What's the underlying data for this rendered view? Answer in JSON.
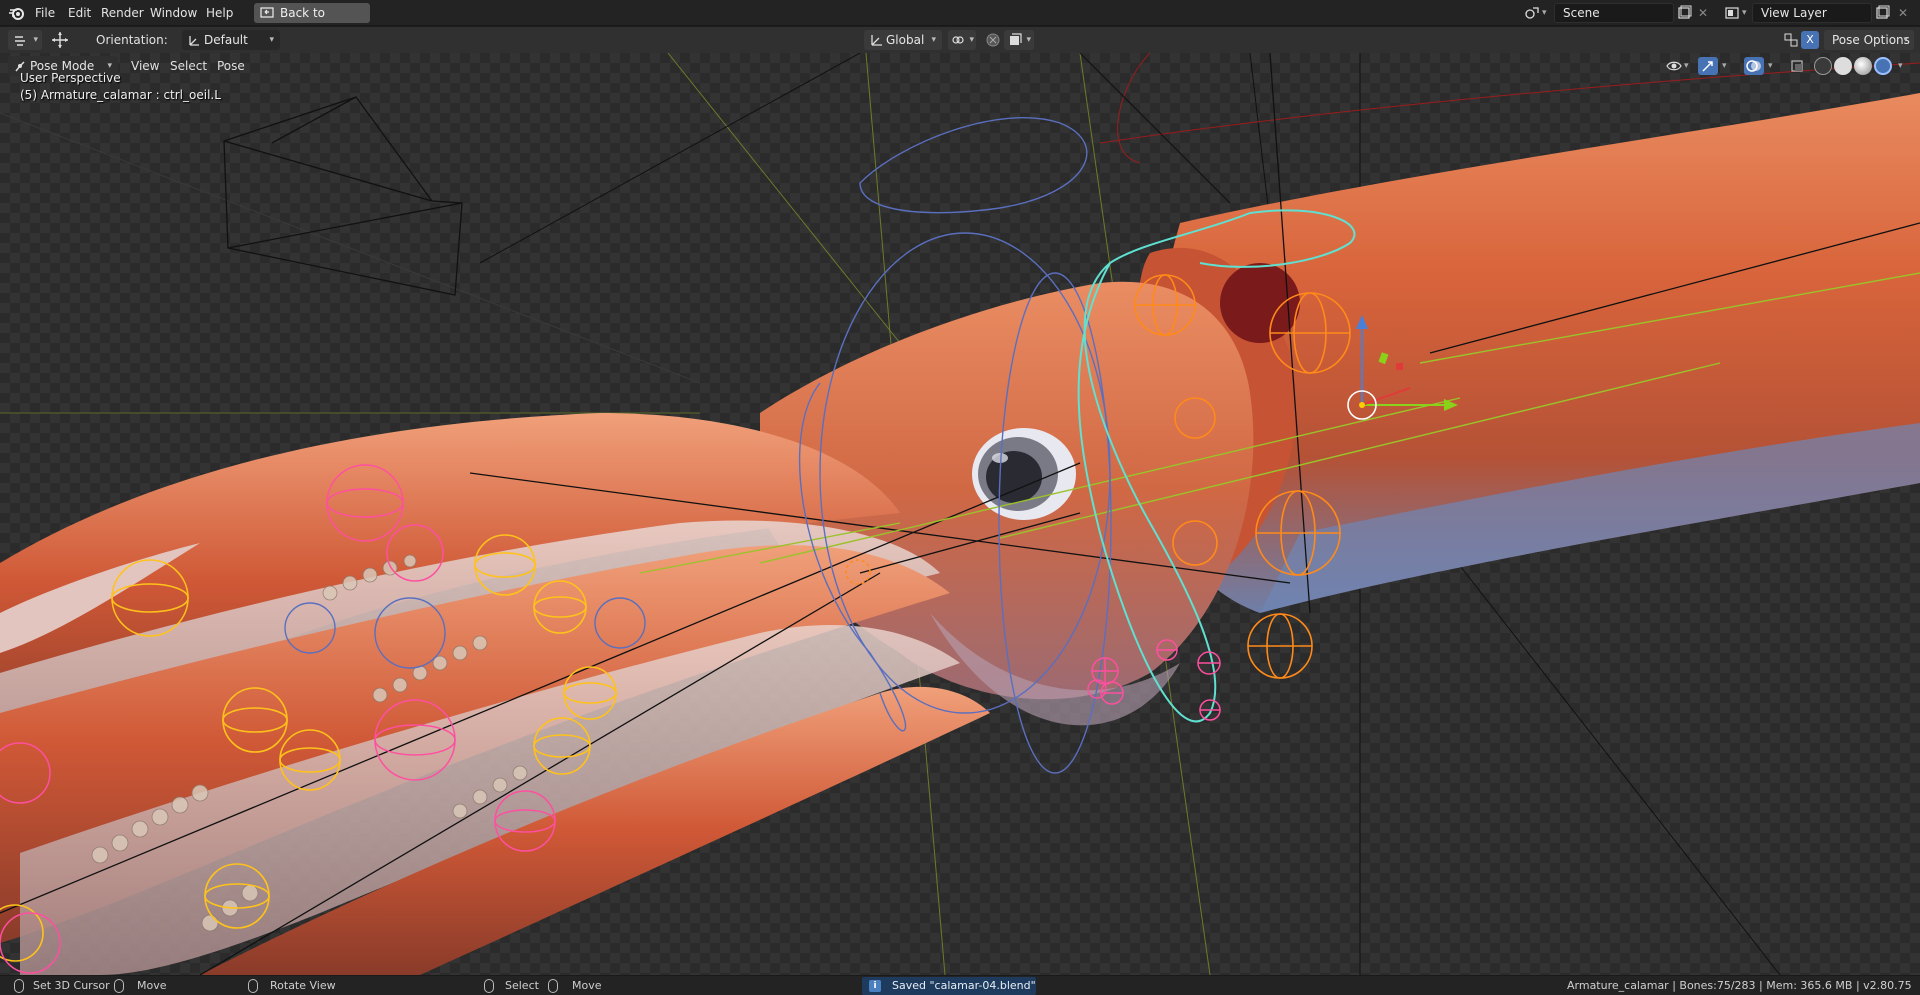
{
  "topbar": {
    "menu": [
      "File",
      "Edit",
      "Render",
      "Window",
      "Help"
    ],
    "back_button": "Back to Previous",
    "scene_field": "Scene",
    "viewlayer_field": "View Layer"
  },
  "header": {
    "orientation_label": "Orientation:",
    "orientation_value": "Default",
    "transform_space": "Global",
    "pose_options": "Pose Options",
    "axis_x_label": "X"
  },
  "viewport": {
    "mode": "Pose Mode",
    "menus": [
      "View",
      "Select",
      "Pose"
    ],
    "overlay_line1": "User Perspective",
    "overlay_line2": "(5) Armature_calamar : ctrl_oeil.L"
  },
  "statusbar": {
    "set_cursor": "Set 3D Cursor",
    "move1": "Move",
    "rotate_view": "Rotate View",
    "select": "Select",
    "move2": "Move",
    "saved_message": "Saved \"calamar-04.blend\"",
    "stats": "Armature_calamar | Bones:75/283 | Mem: 365.6 MB | v2.80.75"
  },
  "colors": {
    "accent_blue": "#4772b3",
    "squid_orange": "#d5643f",
    "bone_orange": "#ff8a1a",
    "bone_pink": "#ff4fa0",
    "bone_yellow": "#ffc21a",
    "bone_cyan": "#5fe0d0",
    "bone_blue": "#5a6fbf"
  }
}
